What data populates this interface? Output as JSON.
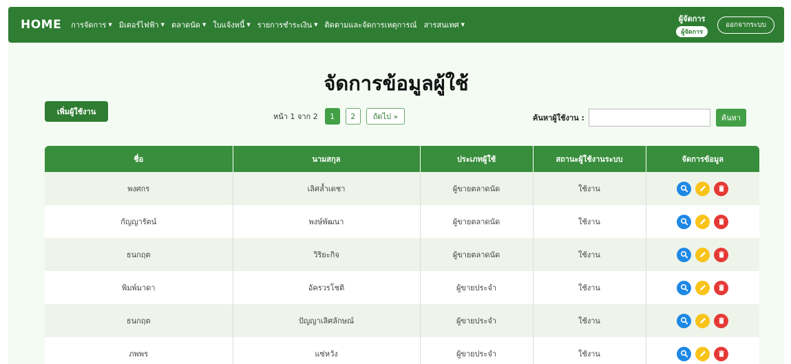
{
  "nav": {
    "brand": "HOME",
    "menu": [
      {
        "label": "การจัดการ",
        "caret": "▼"
      },
      {
        "label": "มิเตอร์ไฟฟ้า",
        "caret": "▼"
      },
      {
        "label": "ตลาดนัด",
        "caret": "▼"
      },
      {
        "label": "ใบแจ้งหนี้",
        "caret": "▼"
      },
      {
        "label": "รายการชำระเงิน",
        "caret": "▼"
      },
      {
        "label": "ติดตามและจัดการเหตุการณ์",
        "caret": ""
      },
      {
        "label": "สารสนเทศ",
        "caret": "▼"
      }
    ],
    "user_name": "ผู้จัดการ",
    "user_role": "ผู้จัดการ",
    "logout_label": "ออกจากระบบ"
  },
  "page_title": "จัดการข้อมูลผู้ใช้",
  "toolbar": {
    "add_label": "เพิ่มผู้ใช้งาน",
    "pagination": {
      "info": "หน้า 1 จาก 2",
      "pages": [
        "1",
        "2"
      ],
      "current": "1",
      "next_label": "ถัดไป »"
    },
    "search": {
      "label": "ค้นหาผู้ใช้งาน :",
      "value": "",
      "button_label": "ค้นหา"
    }
  },
  "table": {
    "headers": [
      "ชื่อ",
      "นามสกุล",
      "ประเภทผู้ใช้",
      "สถานะผู้ใช้งานระบบ",
      "จัดการข้อมูล"
    ],
    "rows": [
      [
        "พงศกร",
        "เลิศล้ำเดชา",
        "ผู้ขายตลาดนัด",
        "ใช้งาน"
      ],
      [
        "กัญญารัตน์",
        "พงษ์พัฒนา",
        "ผู้ขายตลาดนัด",
        "ใช้งาน"
      ],
      [
        "ธนกฤต",
        "วิริยะกิจ",
        "ผู้ขายตลาดนัด",
        "ใช้งาน"
      ],
      [
        "พิมพ์มาดา",
        "อัครวรโชติ",
        "ผู้ขายประจำ",
        "ใช้งาน"
      ],
      [
        "ธนกฤต",
        "ปัญญาเลิศลักษณ์",
        "ผู้ขายประจำ",
        "ใช้งาน"
      ],
      [
        "ภพพร",
        "แซ่หวัง",
        "ผู้ขายประจำ",
        "ใช้งาน"
      ]
    ],
    "action_icons": [
      "search-icon",
      "pencil-icon",
      "trash-icon"
    ]
  },
  "colors": {
    "primary": "#2e7d32",
    "header": "#388e3c",
    "row_alt": "#eef4ea",
    "view": "#1e88e5",
    "edit": "#f9c31a",
    "delete": "#e53935"
  }
}
